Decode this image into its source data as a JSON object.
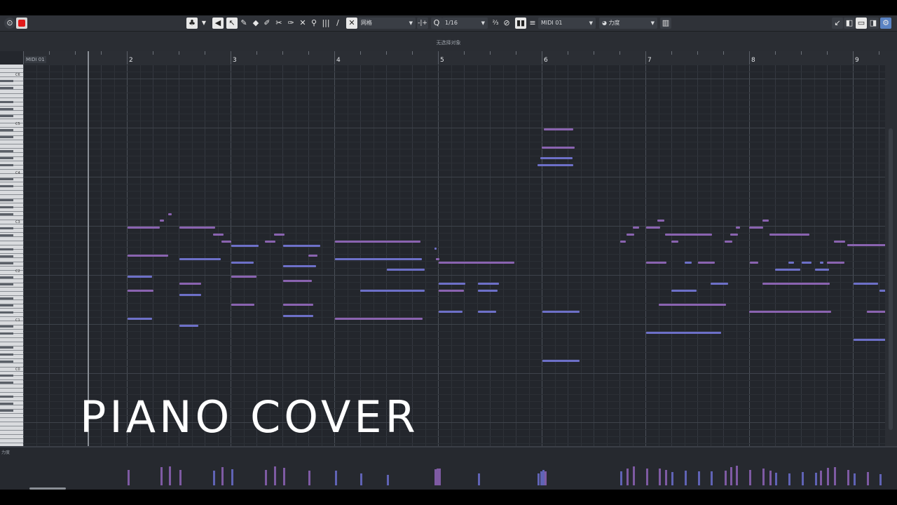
{
  "toolbar": {
    "snap_label": "网格",
    "quantize_value": "1/16",
    "part_name": "MIDI 01",
    "lane_select": "力度"
  },
  "status_text": "无选择对象",
  "ruler": {
    "part_label": "MIDI 01",
    "bars": [
      "2",
      "3",
      "4",
      "5",
      "6",
      "7",
      "8",
      "9"
    ]
  },
  "keyboard": {
    "octaves": [
      "C6",
      "C5",
      "C4",
      "C3",
      "C2",
      "C1",
      "C0"
    ]
  },
  "lane": {
    "label": "力度"
  },
  "overlay_title": "PIANO COVER",
  "colors": {
    "note_purple": "#8a63b0",
    "note_blue": "#6d70c8",
    "background": "#24272d"
  }
}
